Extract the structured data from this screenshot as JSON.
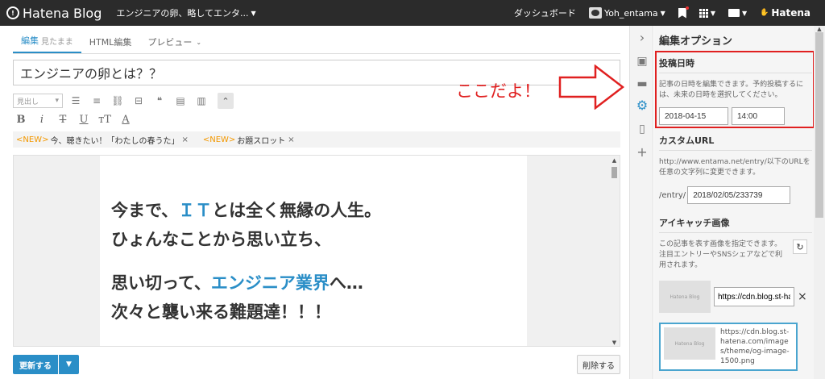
{
  "topbar": {
    "logo": "Hatena Blog",
    "blog_title": "エンジニアの卵、略してエンタ...",
    "dashboard": "ダッシュボード",
    "username": "Yoh_entama",
    "brand": "Hatena"
  },
  "tabs": [
    {
      "label": "編集",
      "sub": "見たまま"
    },
    {
      "label": "HTML編集"
    },
    {
      "label": "プレビュー"
    }
  ],
  "editor": {
    "title_value": "エンジニアの卵とは？？",
    "heading_select": "見出し",
    "topics": [
      {
        "tag": "<NEW>",
        "text": "今、聴きたい！「わたしの春うた」"
      },
      {
        "tag": "<NEW>",
        "text": "お題スロット"
      }
    ],
    "content": {
      "line1_prefix": "今まで、",
      "line1_blue": "ＩＴ",
      "line1_suffix": "とは全く無縁の人生。",
      "line2": "ひょんなことから思い立ち、",
      "line3_prefix": "思い切って、",
      "line3_blue": "エンジニア業界",
      "line3_suffix": "へ…",
      "line4": "次々と襲い来る難題達！！！"
    },
    "update_button": "更新する",
    "delete_button": "削除する"
  },
  "annotation": {
    "text": "ここだよ！",
    "color": "#e02020"
  },
  "panel": {
    "title": "編集オプション",
    "post_date": {
      "heading": "投稿日時",
      "desc": "記事の日時を編集できます。予約投稿するには、未来の日時を選択してください。",
      "date": "2018-04-15",
      "time": "14:00"
    },
    "custom_url": {
      "heading": "カスタムURL",
      "desc": "http://www.entama.net/entry/以下のURLを任意の文字列に変更できます。",
      "prefix": "/entry/",
      "value": "2018/02/05/233739"
    },
    "eyecatch": {
      "heading": "アイキャッチ画像",
      "desc": "この記事を表す画像を指定できます。注目エントリーやSNSシェアなどで利用されます。",
      "thumb_label": "Hatena Blog",
      "input_value": "https://cdn.blog.st-ha",
      "card_url": "https://cdn.blog.st-hatena.com/images/theme/og-image-1500.png"
    }
  },
  "colors": {
    "accent": "#2a8ec7",
    "topbar": "#2b2b2b",
    "new_tag": "#f39800"
  }
}
